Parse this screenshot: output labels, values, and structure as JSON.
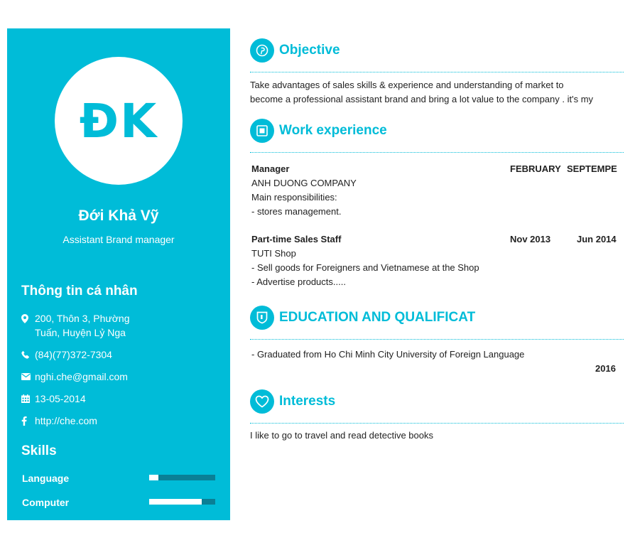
{
  "profile": {
    "initials": "ĐK",
    "name": "Đới Khả Vỹ",
    "title": "Assistant Brand manager"
  },
  "personal_info": {
    "heading": "Thông tin cá nhân",
    "address_line1": "200, Thôn 3, Phường",
    "address_line2": "Tuấn, Huyện Lỷ Nga",
    "phone": "(84)(77)372-7304",
    "email": "nghi.che@gmail.com",
    "birthday": "13-05-2014",
    "website": "http://che.com"
  },
  "skills": {
    "heading": "Skills",
    "items": [
      {
        "label": "Language",
        "level": 0.14
      },
      {
        "label": "Computer",
        "level": 0.8
      }
    ]
  },
  "objective": {
    "heading": "Objective",
    "line1": "Take advantages of sales skills & experience and understanding of market to",
    "line2": "become a professional assistant brand and bring a lot value to the company . it's my"
  },
  "work": {
    "heading": "Work experience",
    "jobs": [
      {
        "title": "Manager",
        "start": "FEBRUARY",
        "end": "SEPTEMPE",
        "company": "ANH DUONG COMPANY",
        "line1": "Main responsibilities:",
        "line2": "- stores management."
      },
      {
        "title": "Part-time Sales Staff",
        "start": "Nov 2013",
        "end": "Jun 2014",
        "company": "TUTI Shop",
        "line1": "- Sell goods for Foreigners and Vietnamese at the Shop",
        "line2": "- Advertise products....."
      }
    ]
  },
  "education": {
    "heading": "EDUCATION AND QUALIFICAT",
    "line1": "- Graduated from Ho Chi Minh City University of Foreign Language",
    "year": "2016"
  },
  "interests": {
    "heading": "Interests",
    "line1": "I like to go to travel and read detective books"
  },
  "colors": {
    "accent": "#00bcd8",
    "bar_track": "#0a7f95"
  }
}
